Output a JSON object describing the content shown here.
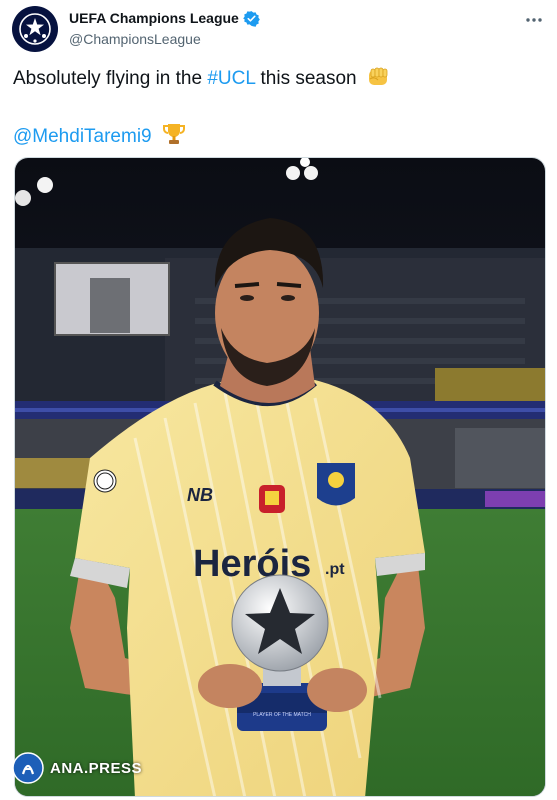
{
  "account": {
    "display_name": "UEFA Champions League",
    "handle": "@ChampionsLeague",
    "verified": true,
    "avatar_icon": "champions-league-starball-icon"
  },
  "header": {
    "more_icon": "more-horizontal-icon"
  },
  "tweet": {
    "text_before": "Absolutely flying in the ",
    "hashtag": "#UCL",
    "text_after": " this season",
    "emoji_1": "raised-fist-emoji",
    "mention": "@MehdiTaremi9",
    "emoji_2": "trophy-emoji"
  },
  "media": {
    "description_icon": "player-holding-trophy-photo",
    "shirt_sponsor": "Heróis",
    "shirt_sponsor_suffix": ".pt",
    "trophy_plate": "PLAYER OF THE MATCH"
  },
  "watermark": {
    "text": "ANA.PRESS"
  },
  "colors": {
    "link": "#1d9bf0",
    "verified": "#1d9bf0",
    "muted": "#536471",
    "jersey": "#f4e28c"
  }
}
